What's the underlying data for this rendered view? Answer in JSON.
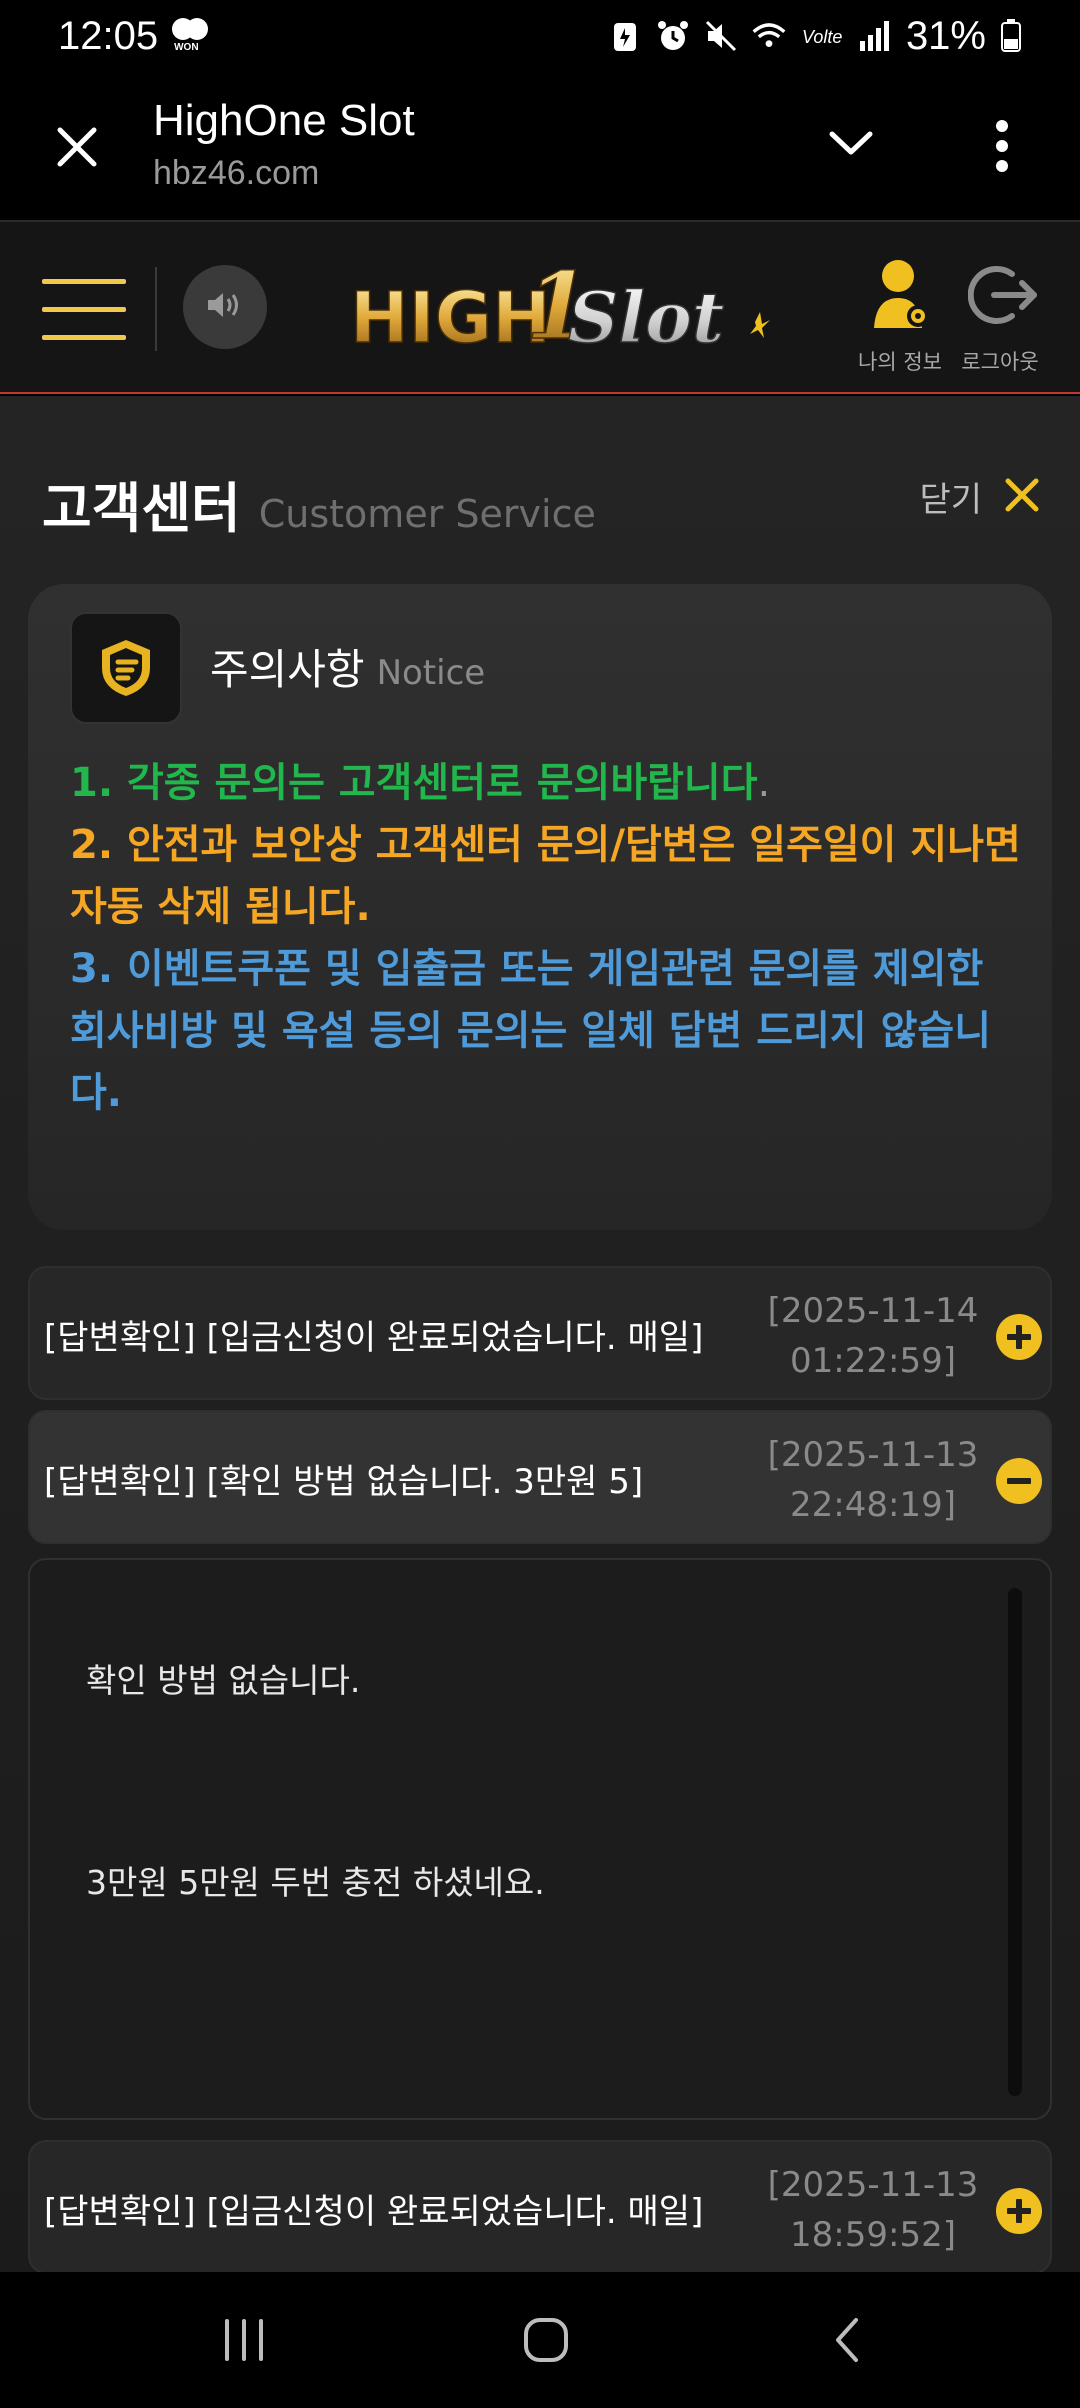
{
  "status_bar": {
    "time": "12:05",
    "won_badge": "WON",
    "battery": "31%",
    "icons": [
      "battery-saver-icon",
      "alarm-icon",
      "mute-icon",
      "wifi-icon",
      "volte-icon",
      "signal-icon",
      "battery-icon"
    ]
  },
  "browser": {
    "title": "HighOne Slot",
    "url": "hbz46.com"
  },
  "header": {
    "logo_text": "HIGH1Slot",
    "my_info_label": "나의 정보",
    "logout_label": "로그아웃"
  },
  "page": {
    "title": "고객센터",
    "subtitle": "Customer Service",
    "close_label": "닫기"
  },
  "notice": {
    "title": "주의사항",
    "title_en": "Notice",
    "line1": "1. 각종 문의는 고객센터로 문의바랍니다",
    "line1_dot": ".",
    "line2": "2. 안전과 보안상 고객센터 문의/답변은 일주일이 지나면 자동 삭제 됩니다.",
    "line3": "3. 이벤트쿠폰 및 입출금 또는 게임관련 문의를 제외한 회사비방 및 욕설 등의 문의는 일체 답변 드리지 않습니다."
  },
  "inquiries": [
    {
      "title": "[답변확인] [입금신청이 완료되었습니다. 매일]",
      "date": "[2025-11-14",
      "time": "01:22:59]",
      "expanded": false
    },
    {
      "title": "[답변확인] [확인 방법 없습니다. 3만원 5]",
      "date": "[2025-11-13",
      "time": "22:48:19]",
      "expanded": true
    },
    {
      "title": "[답변확인] [입금신청이 완료되었습니다. 매일]",
      "date": "[2025-11-13",
      "time": "18:59:52]",
      "expanded": false
    }
  ],
  "answer": {
    "line1": "확인 방법 없습니다.",
    "line2": "3만원 5만원 두번 충전 하셨네요."
  },
  "colors": {
    "accent_gold": "#f0c94b",
    "green": "#22b74c",
    "orange": "#f5a623",
    "blue": "#4f9bd9",
    "header_border": "#c0392b"
  }
}
